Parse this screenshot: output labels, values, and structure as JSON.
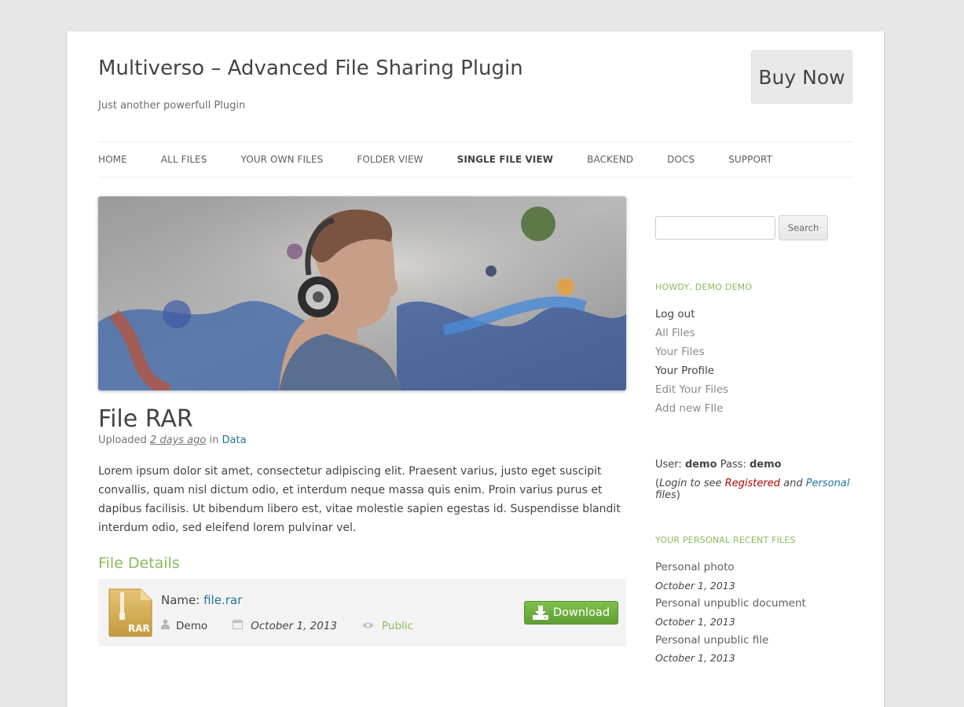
{
  "header": {
    "site_title": "Multiverso – Advanced File Sharing Plugin",
    "site_description": "Just another powerfull Plugin",
    "buy_button": "Buy Now"
  },
  "nav": {
    "items": [
      "HOME",
      "ALL FILES",
      "YOUR OWN FILES",
      "FOLDER VIEW",
      "SINGLE FILE VIEW",
      "BACKEND",
      "DOCS",
      "SUPPORT"
    ],
    "active": "SINGLE FILE VIEW"
  },
  "entry": {
    "title": "File RAR",
    "meta_prefix": "Uploaded",
    "meta_ago": "2 days ago",
    "meta_in": "in",
    "meta_category": "Data",
    "excerpt": "Lorem ipsum dolor sit amet, consectetur adipiscing elit. Praesent varius, justo eget suscipit convallis, quam nisl dictum odio, et interdum neque massa quis enim. Proin varius purus et dapibus facilisis. Ut bibendum libero est, vitae molestie sapien egestas id. Suspendisse blandit interdum odio, sed eleifend lorem pulvinar vel."
  },
  "file_details": {
    "heading": "File Details",
    "icon_label": "RAR",
    "name_label": "Name:",
    "name_value": "file.rar",
    "author": "Demo",
    "date": "October 1, 2013",
    "visibility": "Public",
    "download_label": "Download"
  },
  "sidebar": {
    "search_button": "Search",
    "howdy_heading": "HOWDY, DEMO DEMO",
    "user_links": [
      {
        "label": "Log out",
        "style": "dark"
      },
      {
        "label": "All Files",
        "style": "light"
      },
      {
        "label": "Your Files",
        "style": "light"
      },
      {
        "label": "Your Profile",
        "style": "dark"
      },
      {
        "label": "Edit Your Files",
        "style": "light"
      },
      {
        "label": "Add new FIle",
        "style": "light"
      }
    ],
    "user_label": "User:",
    "user_value": "demo",
    "pass_label": "Pass:",
    "pass_value": "demo",
    "login_note_pre": "Login to see",
    "login_note_registered": "Registered",
    "login_note_and": "and",
    "login_note_personal": "Personal",
    "login_note_post": "files",
    "recent_heading": "YOUR PERSONAL RECENT FILES",
    "recent_files": [
      {
        "title": "Personal photo",
        "date": "October 1, 2013"
      },
      {
        "title": "Personal unpublic document",
        "date": "October 1, 2013"
      },
      {
        "title": "Personal unpublic file",
        "date": "October 1, 2013"
      }
    ]
  },
  "colors": {
    "accent_green": "#8cb95b",
    "link_blue": "#21759b",
    "registered_red": "#b30000"
  }
}
